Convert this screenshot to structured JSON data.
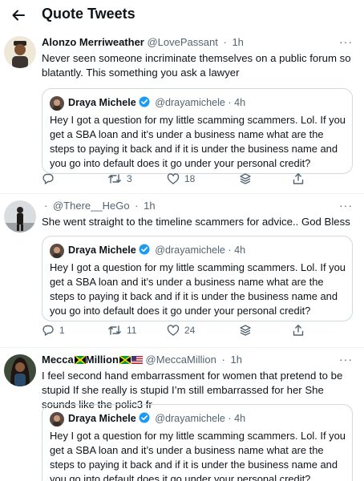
{
  "header": {
    "title": "Quote Tweets",
    "back_icon": "arrow-left-icon"
  },
  "quoted": {
    "name": "Draya Michele",
    "handle": "@drayamichele",
    "time": "4h",
    "text": "Hey I got a question for my little scamming scammers.   Lol.  If you get a SBA loan and it’s under a business name what are the steps to paying it back and if it is under the business name and you go into default does it go under your personal credit?"
  },
  "tweets": [
    {
      "name": "Alonzo Merriweather",
      "handle": "@LovePassant",
      "time": "1h",
      "text": "Never seen someone incriminate themselves on a public forum so blatantly. This something you ask a lawyer",
      "replies": "",
      "retweets": "3",
      "likes": "18"
    },
    {
      "name": "",
      "handle": "@There__HeGo",
      "time": "1h",
      "text": "She went straight to the timeline scammers for advice.. God Bless",
      "replies": "1",
      "retweets": "11",
      "likes": "24"
    },
    {
      "name_a": "Mecca",
      "name_b": "Million",
      "handle": "@MeccaMillion",
      "time": "1h",
      "text": "I feel second hand embarrassment for women that pretend to be stupid If she really is stupid I’m still embarrassed for her She sounds like the polic3 fr"
    }
  ],
  "more_label": "···",
  "dot": "·",
  "colors": {
    "text": "#0f1419",
    "secondary": "#536471",
    "border": "#cfd9de",
    "verified": "#1d9bf0"
  }
}
